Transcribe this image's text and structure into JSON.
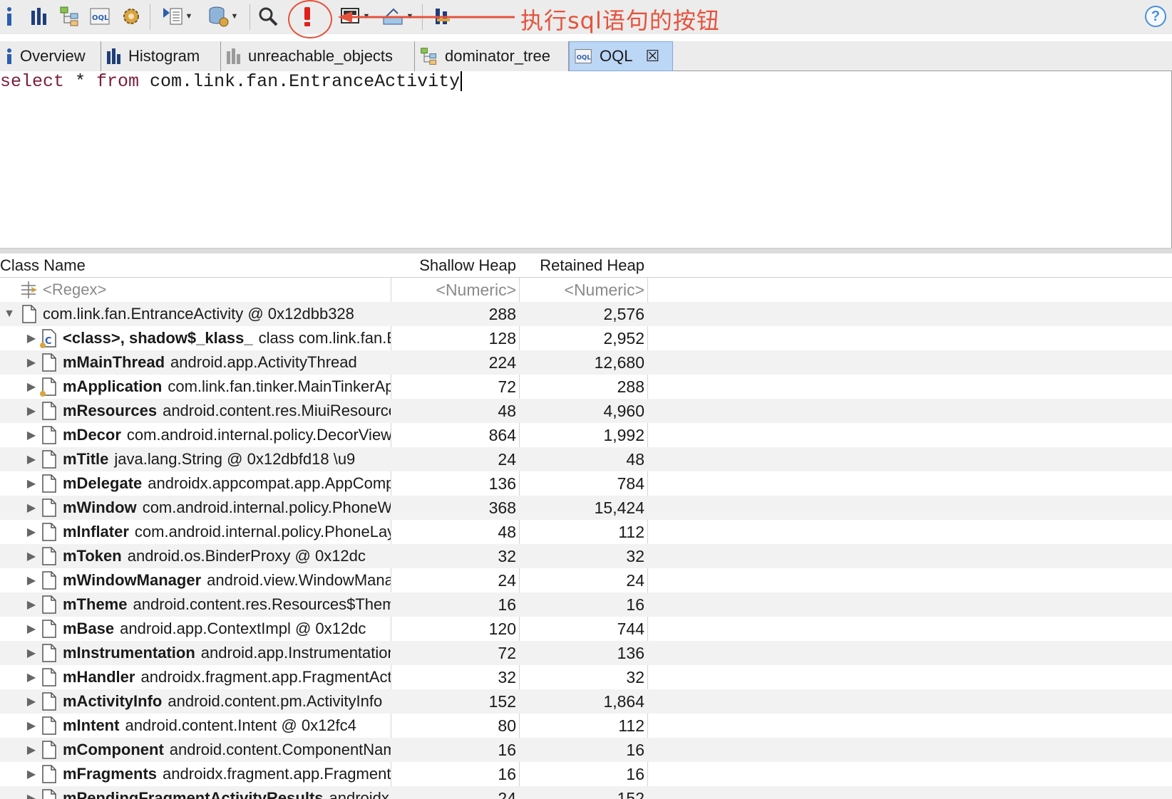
{
  "annotation": {
    "text": "执行sql语句的按钮",
    "color": "#e5533d"
  },
  "help_label": "?",
  "tabs": [
    {
      "label": "Overview",
      "icon": "info-icon"
    },
    {
      "label": "Histogram",
      "icon": "histogram-icon"
    },
    {
      "label": "unreachable_objects",
      "icon": "histogram-gray-icon"
    },
    {
      "label": "dominator_tree",
      "icon": "dominator-tree-icon"
    },
    {
      "label": "OQL",
      "icon": "oql-icon",
      "active": true,
      "close": "☒"
    }
  ],
  "editor": {
    "kw_select": "select",
    "star": " * ",
    "kw_from": "from",
    "rest": " com.link.fan.EntranceActivity"
  },
  "table": {
    "headers": {
      "class_name": "Class Name",
      "shallow": "Shallow Heap",
      "retained": "Retained Heap"
    },
    "filter": {
      "name": "<Regex>",
      "shallow": "<Numeric>",
      "retained": "<Numeric>"
    },
    "root": {
      "name": "com.link.fan.EntranceActivity @ 0x12dbb328",
      "shallow": "288",
      "retained": "2,576"
    },
    "rows": [
      {
        "field": "<class>, shadow$_klass_",
        "value": "class com.link.fan.EntranceActivity",
        "shallow": "128",
        "retained": "2,952",
        "icon": "class-icon"
      },
      {
        "field": "mMainThread",
        "value": "android.app.ActivityThread",
        "shallow": "224",
        "retained": "12,680",
        "icon": "object-icon"
      },
      {
        "field": "mApplication",
        "value": "com.link.fan.tinker.MainTinkerApplication",
        "shallow": "72",
        "retained": "288",
        "icon": "gc-root-icon"
      },
      {
        "field": "mResources",
        "value": "android.content.res.MiuiResources",
        "shallow": "48",
        "retained": "4,960",
        "icon": "object-icon"
      },
      {
        "field": "mDecor",
        "value": "com.android.internal.policy.DecorView",
        "shallow": "864",
        "retained": "1,992",
        "icon": "object-icon"
      },
      {
        "field": "mTitle",
        "value": "java.lang.String @ 0x12dbfd18  \\u9",
        "shallow": "24",
        "retained": "48",
        "icon": "object-icon"
      },
      {
        "field": "mDelegate",
        "value": "androidx.appcompat.app.AppCompatDelegate",
        "shallow": "136",
        "retained": "784",
        "icon": "object-icon"
      },
      {
        "field": "mWindow",
        "value": "com.android.internal.policy.PhoneWindow",
        "shallow": "368",
        "retained": "15,424",
        "icon": "object-icon"
      },
      {
        "field": "mInflater",
        "value": "com.android.internal.policy.PhoneLayoutInflater",
        "shallow": "48",
        "retained": "112",
        "icon": "object-icon"
      },
      {
        "field": "mToken",
        "value": "android.os.BinderProxy @ 0x12dc",
        "shallow": "32",
        "retained": "32",
        "icon": "object-icon"
      },
      {
        "field": "mWindowManager",
        "value": "android.view.WindowManagerImpl",
        "shallow": "24",
        "retained": "24",
        "icon": "object-icon"
      },
      {
        "field": "mTheme",
        "value": "android.content.res.Resources$Theme",
        "shallow": "16",
        "retained": "16",
        "icon": "object-icon"
      },
      {
        "field": "mBase",
        "value": "android.app.ContextImpl @ 0x12dc",
        "shallow": "120",
        "retained": "744",
        "icon": "object-icon"
      },
      {
        "field": "mInstrumentation",
        "value": "android.app.Instrumentation",
        "shallow": "72",
        "retained": "136",
        "icon": "object-icon"
      },
      {
        "field": "mHandler",
        "value": "androidx.fragment.app.FragmentActivity",
        "shallow": "32",
        "retained": "32",
        "icon": "object-icon"
      },
      {
        "field": "mActivityInfo",
        "value": "android.content.pm.ActivityInfo",
        "shallow": "152",
        "retained": "1,864",
        "icon": "object-icon"
      },
      {
        "field": "mIntent",
        "value": "android.content.Intent @ 0x12fc4",
        "shallow": "80",
        "retained": "112",
        "icon": "object-icon"
      },
      {
        "field": "mComponent",
        "value": "android.content.ComponentName",
        "shallow": "16",
        "retained": "16",
        "icon": "object-icon"
      },
      {
        "field": "mFragments",
        "value": "androidx.fragment.app.FragmentController",
        "shallow": "16",
        "retained": "16",
        "icon": "object-icon"
      },
      {
        "field": "mPendingFragmentActivityResults",
        "value": "androidx.collection.SparseArrayCompat",
        "shallow": "24",
        "retained": "152",
        "icon": "object-icon"
      }
    ]
  }
}
